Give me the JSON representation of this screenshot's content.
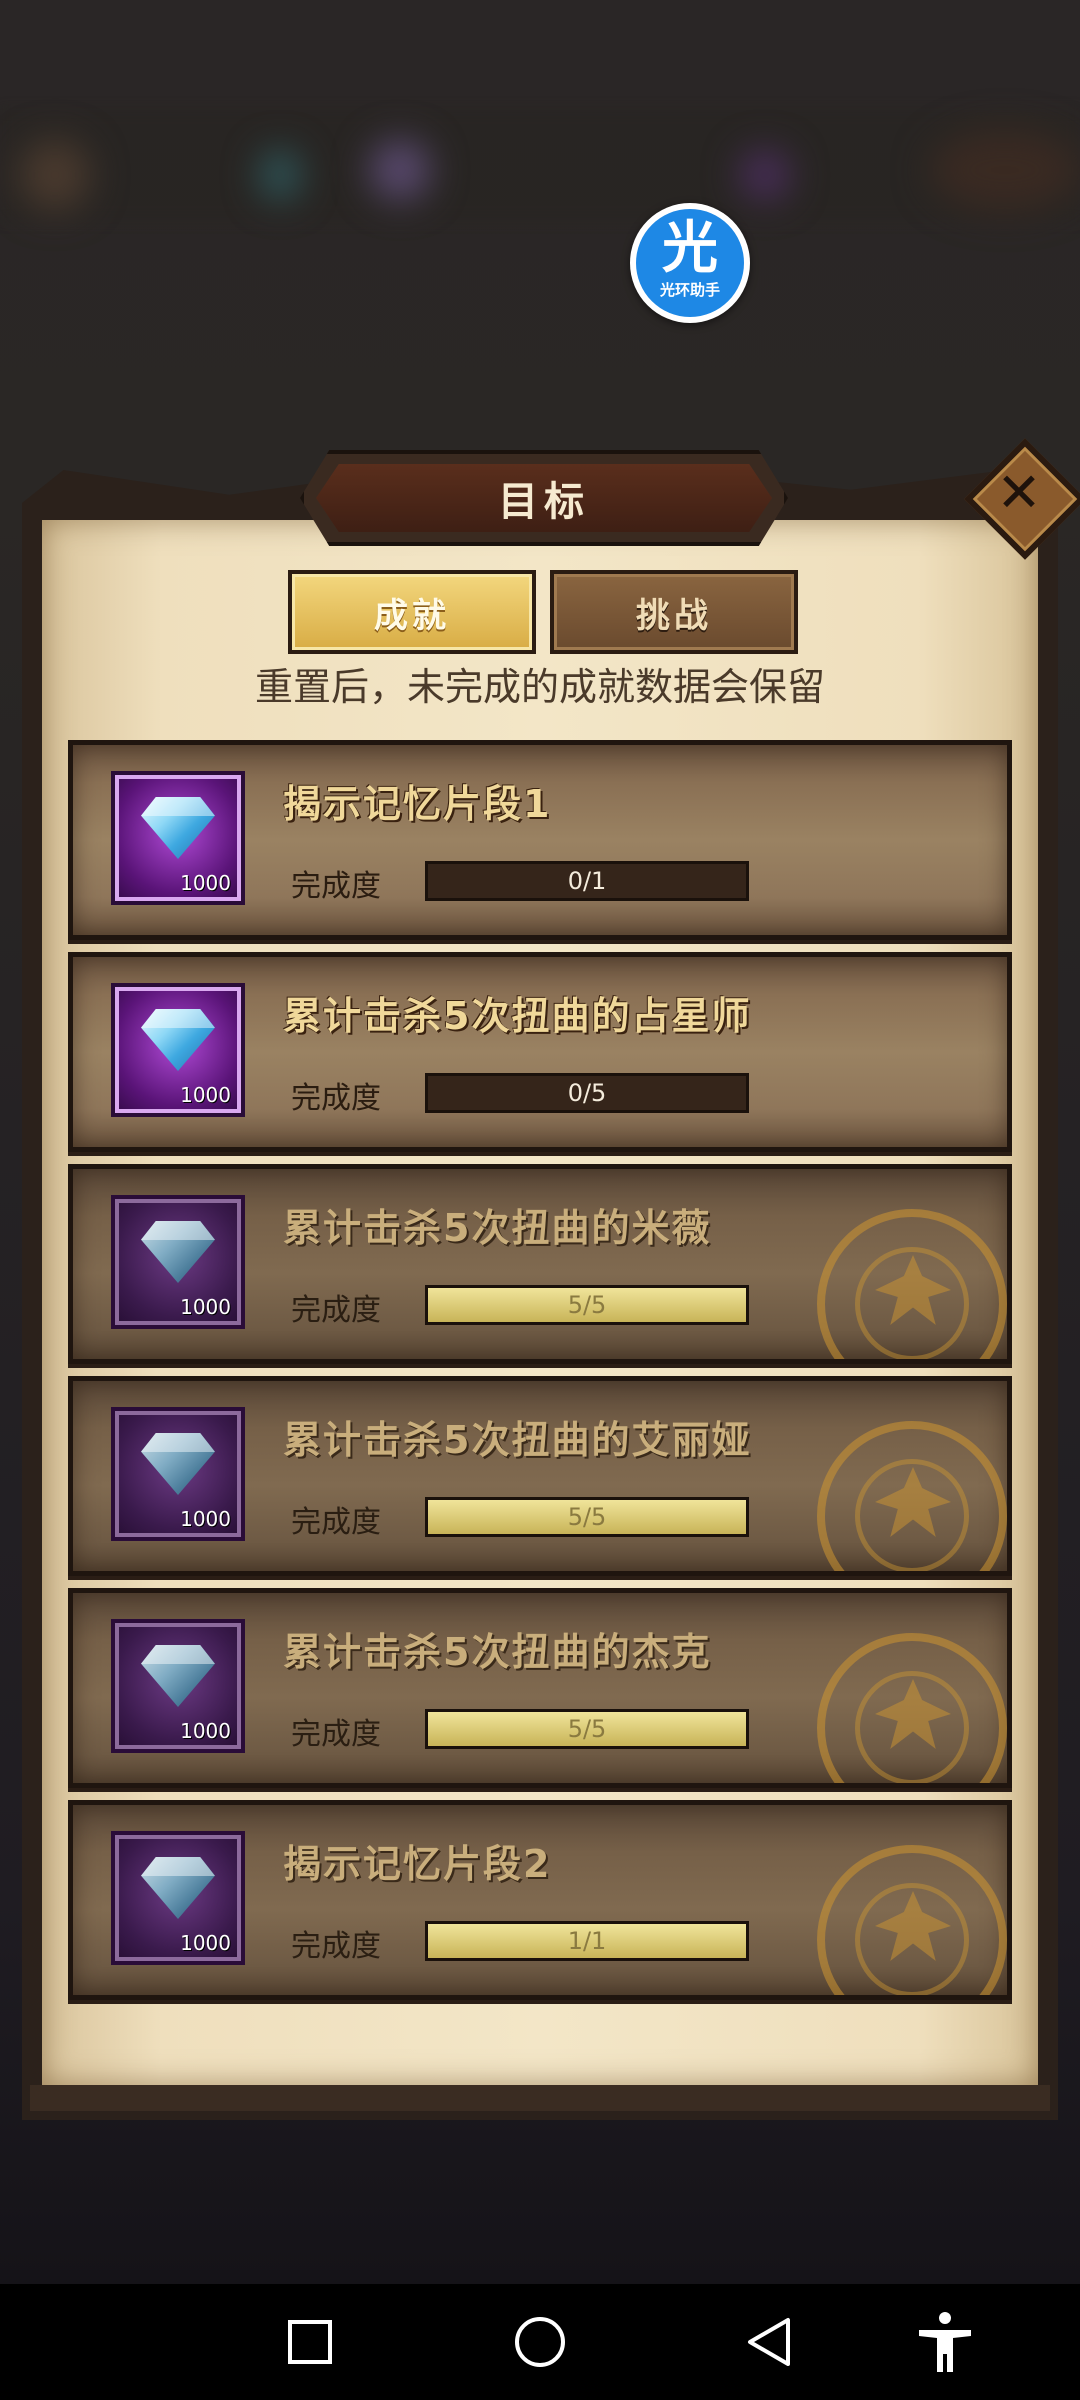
{
  "overlay": {
    "helper_badge": {
      "icon": "guanghuan-helper-icon",
      "char": "光",
      "label": "光环助手"
    }
  },
  "panel": {
    "title": "目标",
    "close_icon": "close-icon",
    "tabs": [
      {
        "label": "成就",
        "active": true
      },
      {
        "label": "挑战",
        "active": false
      }
    ],
    "subtitle": "重置后，未完成的成就数据会保留",
    "progress_label": "完成度",
    "colors": {
      "accent_gold": "#d8ac44",
      "reward_purple": "#5a1478",
      "progress_fill": "#e0d27a"
    },
    "achievements": [
      {
        "title": "揭示记忆片段1",
        "reward_icon": "diamond-icon",
        "reward_amount": "1000",
        "progress_text": "0/1",
        "progress": 0,
        "completed": false
      },
      {
        "title": "累计击杀5次扭曲的占星师",
        "reward_icon": "diamond-icon",
        "reward_amount": "1000",
        "progress_text": "0/5",
        "progress": 0,
        "completed": false
      },
      {
        "title": "累计击杀5次扭曲的米薇",
        "reward_icon": "diamond-icon",
        "reward_amount": "1000",
        "progress_text": "5/5",
        "progress": 1,
        "completed": true
      },
      {
        "title": "累计击杀5次扭曲的艾丽娅",
        "reward_icon": "diamond-icon",
        "reward_amount": "1000",
        "progress_text": "5/5",
        "progress": 1,
        "completed": true
      },
      {
        "title": "累计击杀5次扭曲的杰克",
        "reward_icon": "diamond-icon",
        "reward_amount": "1000",
        "progress_text": "5/5",
        "progress": 1,
        "completed": true
      },
      {
        "title": "揭示记忆片段2",
        "reward_icon": "diamond-icon",
        "reward_amount": "1000",
        "progress_text": "1/1",
        "progress": 1,
        "completed": true
      }
    ]
  },
  "navbar": {
    "buttons": [
      "recent-apps-icon",
      "home-icon",
      "back-icon",
      "accessibility-icon"
    ]
  }
}
